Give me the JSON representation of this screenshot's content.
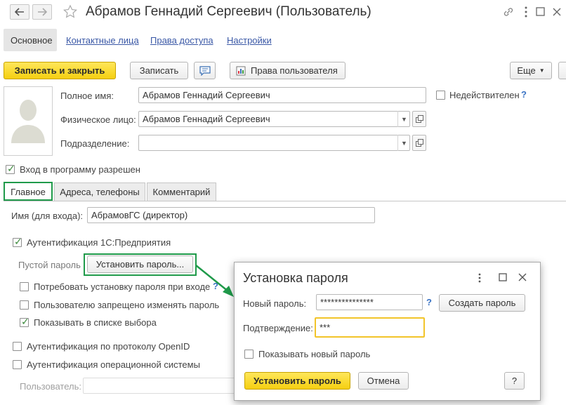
{
  "window": {
    "title": "Абрамов Геннадий Сергеевич (Пользователь)"
  },
  "nav": {
    "back_icon": "arrow-left-icon",
    "forward_icon": "arrow-right-icon",
    "favorite_icon": "star-icon"
  },
  "window_controls": {
    "link_icon": "link-icon",
    "menu_icon": "more-vertical-icon",
    "maximize_icon": "maximize-icon",
    "close_icon": "close-icon"
  },
  "sections": [
    "Основное",
    "Контактные лица",
    "Права доступа",
    "Настройки"
  ],
  "toolbar": {
    "save_close": "Записать и закрыть",
    "save": "Записать",
    "user_rights": "Права пользователя",
    "more": "Еще"
  },
  "form": {
    "full_name_label": "Полное имя:",
    "full_name_value": "Абрамов Геннадий Сергеевич",
    "inactive_label": "Недействителен",
    "help_mark": "?",
    "person_label": "Физическое лицо:",
    "person_value": "Абрамов Геннадий Сергеевич",
    "department_label": "Подразделение:",
    "department_value": "",
    "login_allowed_label": "Вход в программу разрешен"
  },
  "tabs": [
    "Главное",
    "Адреса, телефоны",
    "Комментарий"
  ],
  "main_tab": {
    "login_name_label": "Имя (для входа):",
    "login_name_value": "АбрамовГС (директор)",
    "auth_1c_label": "Аутентификация 1С:Предприятия",
    "empty_password_label": "Пустой пароль",
    "set_password_button": "Установить пароль...",
    "require_password_label": "Потребовать установку пароля при входе",
    "help_mark": "?",
    "forbid_change_label": "Пользователю запрещено изменять пароль",
    "show_in_list_label": "Показывать в списке выбора",
    "openid_label": "Аутентификация по протоколу OpenID",
    "os_auth_label": "Аутентификация операционной системы",
    "os_user_label": "Пользователь:"
  },
  "dialog": {
    "title": "Установка пароля",
    "new_password_label": "Новый пароль:",
    "new_password_value": "***************",
    "help_mark": "?",
    "create_password_button": "Создать пароль",
    "confirm_label": "Подтверждение:",
    "confirm_value": "***",
    "show_password_label": "Показывать новый пароль",
    "set_password_button": "Установить пароль",
    "cancel_button": "Отмена",
    "help_button": "?"
  },
  "colors": {
    "accent_yellow": "#f5cf11",
    "highlight_green": "#1f9a4a",
    "link_blue": "#3a58a6"
  }
}
